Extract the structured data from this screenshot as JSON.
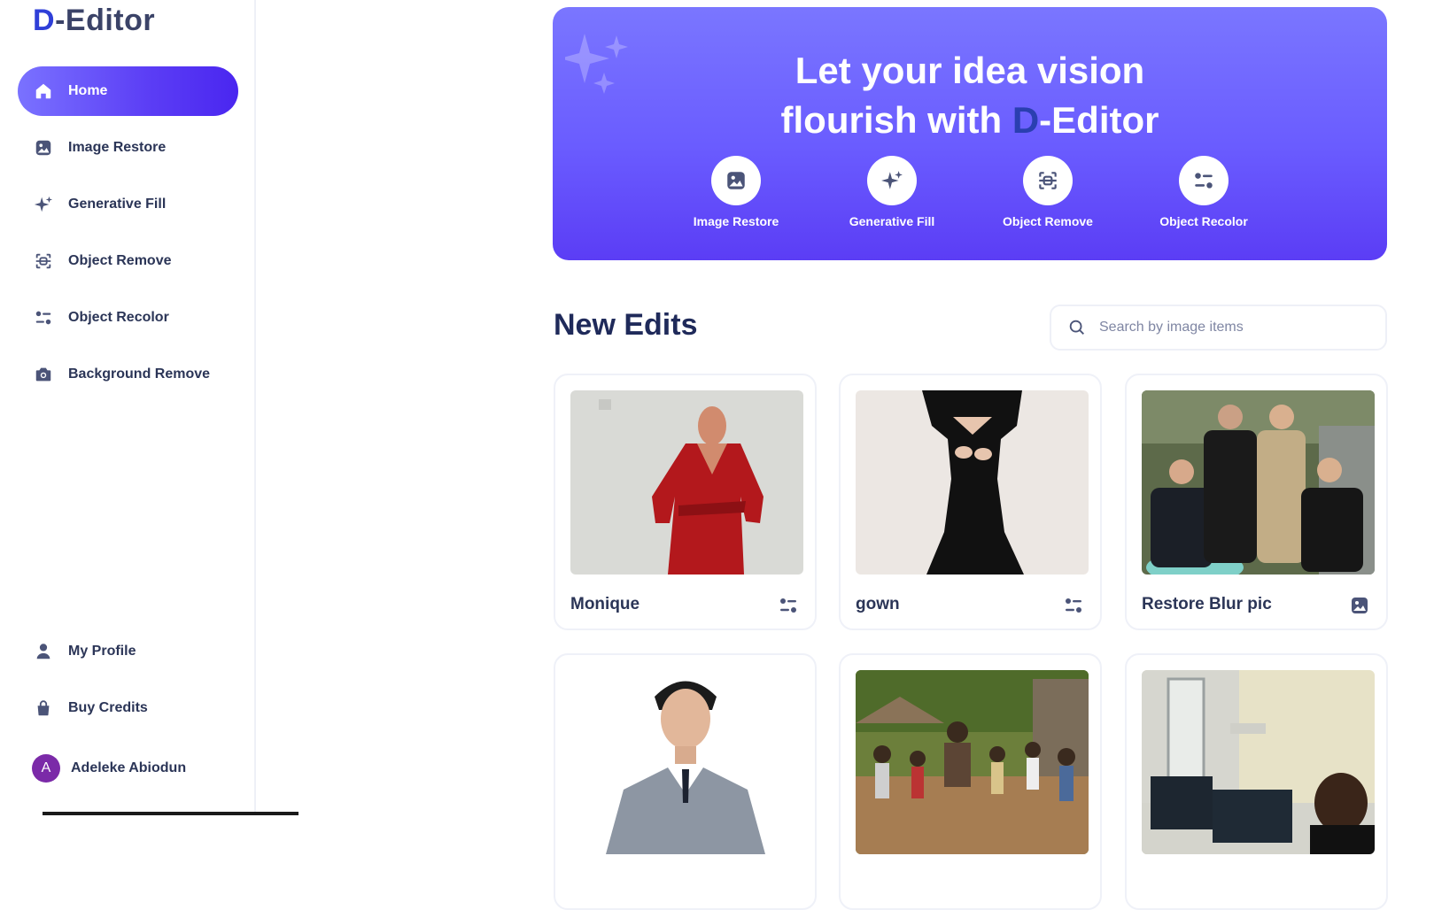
{
  "app": {
    "logo_prefix": "D",
    "logo_rest": "-Editor"
  },
  "sidebar": {
    "items": [
      {
        "label": "Home",
        "icon": "home-icon",
        "active": true
      },
      {
        "label": "Image Restore",
        "icon": "image-icon",
        "active": false
      },
      {
        "label": "Generative Fill",
        "icon": "sparkle-icon",
        "active": false
      },
      {
        "label": "Object Remove",
        "icon": "scan-icon",
        "active": false
      },
      {
        "label": "Object Recolor",
        "icon": "recolor-icon",
        "active": false
      },
      {
        "label": "Background Remove",
        "icon": "camera-icon",
        "active": false
      }
    ],
    "bottom_items": [
      {
        "label": "My Profile",
        "icon": "user-icon"
      },
      {
        "label": "Buy Credits",
        "icon": "bag-icon"
      }
    ],
    "user": {
      "initial": "A",
      "name": "Adeleke Abiodun"
    }
  },
  "hero": {
    "line1": "Let your idea vision",
    "line2_pre": "flourish with ",
    "line2_d": "D",
    "line2_post": "-Editor",
    "tools": [
      {
        "label": "Image Restore",
        "icon": "image-icon"
      },
      {
        "label": "Generative Fill",
        "icon": "sparkle-icon"
      },
      {
        "label": "Object Remove",
        "icon": "scan-icon"
      },
      {
        "label": "Object Recolor",
        "icon": "recolor-icon"
      }
    ]
  },
  "main": {
    "section_title": "New Edits",
    "search_placeholder": "Search by image items",
    "cards": [
      {
        "name": "Monique",
        "icon": "recolor-icon"
      },
      {
        "name": "gown",
        "icon": "recolor-icon"
      },
      {
        "name": "Restore Blur pic",
        "icon": "image-icon"
      },
      {
        "name": "",
        "icon": ""
      },
      {
        "name": "",
        "icon": ""
      },
      {
        "name": "",
        "icon": ""
      }
    ]
  },
  "colors": {
    "accent": "#5b3df5",
    "text": "#2b3557",
    "logo_d": "#2f3fd8"
  }
}
